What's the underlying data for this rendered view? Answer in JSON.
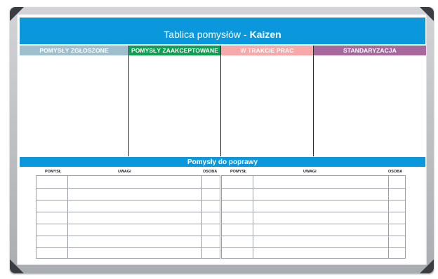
{
  "board": {
    "title_prefix": "Tablica pomysłów - ",
    "title_emphasis": "Kaizen"
  },
  "columns": [
    {
      "label": "POMYSŁY ZGŁOSZONE",
      "color": "#9fbfcf"
    },
    {
      "label": "POMYSŁY ZAAKCEPTOWANE",
      "color": "#0e9f52"
    },
    {
      "label": "W TRAKCIE PRAC",
      "color": "#f7a8a8"
    },
    {
      "label": "STANDARYZACJA",
      "color": "#a5679c"
    }
  ],
  "improvement_section": {
    "title": "Pomysły do poprawy",
    "table_headers": {
      "idea": "POMYSŁ",
      "notes": "UWAGI",
      "person": "OSOBA"
    },
    "rows_per_table": 7
  },
  "colors": {
    "header_blue": "#0a97dc",
    "frame": "#b9bcc0",
    "corner": "#3a3d42"
  }
}
